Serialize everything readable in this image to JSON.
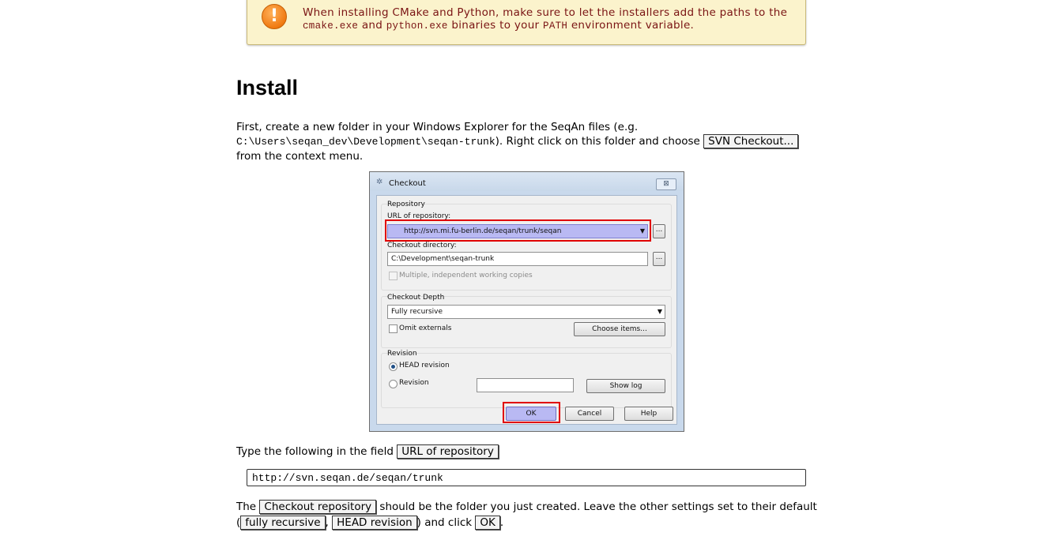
{
  "warning": {
    "icon": "exclamation-icon",
    "text_1": "When installing CMake and Python, make sure to let the installers add the paths to the",
    "code_cmake": "cmake.exe",
    "text_and": "and",
    "code_python": "python.exe",
    "text_2": "binaries to your",
    "code_path": "PATH",
    "text_3": "environment variable."
  },
  "heading": "Install",
  "para1": {
    "text_1": "First, create a new folder in your Windows Explorer for the SeqAn files (e.g.",
    "code_path": "C:\\Users\\seqan_dev\\Development\\seqan-trunk",
    "text_2": "). Right click on this folder and choose",
    "gui_label": "SVN Checkout...",
    "text_3": "from the context menu."
  },
  "dialog": {
    "title": "Checkout",
    "close_label": "⊠",
    "repository_group": "Repository",
    "url_label": "URL of repository:",
    "url_value": "http://svn.mi.fu-berlin.de/seqan/trunk/seqan",
    "browse_label": "...",
    "checkout_dir_label": "Checkout directory:",
    "checkout_dir_value": "C:\\Development\\seqan-trunk",
    "multiple_label": "Multiple, independent working copies",
    "depth_group": "Checkout Depth",
    "depth_value": "Fully recursive",
    "omit_label": "Omit externals",
    "choose_items": "Choose items...",
    "revision_group": "Revision",
    "head_revision": "HEAD revision",
    "revision_label": "Revision",
    "show_log": "Show log",
    "ok": "OK",
    "cancel": "Cancel",
    "help": "Help"
  },
  "para2": {
    "text_1": "Type the following in the field",
    "gui_label": "URL of repository"
  },
  "code_url": "http://svn.seqan.de/seqan/trunk",
  "para3": {
    "text_1": "The",
    "gui_checkout": "Checkout repository",
    "text_2": "should be the folder you just created. Leave the other settings set to their default",
    "text_open": "(",
    "gui_recursive": "fully recursive",
    "text_comma": ",",
    "gui_head": "HEAD revision",
    "text_3": ") and click",
    "gui_ok": "OK",
    "text_end": "."
  }
}
